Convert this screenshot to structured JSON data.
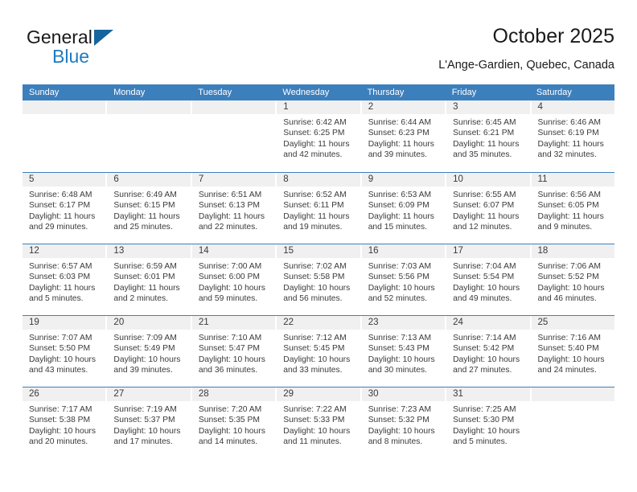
{
  "brand": {
    "word_one": "General",
    "word_two": "Blue",
    "accent_color": "#1f7bc1",
    "triangle_color": "#14659e"
  },
  "header": {
    "title": "October 2025",
    "location": "L'Ange-Gardien, Quebec, Canada"
  },
  "calendar": {
    "header_bg": "#3c7fbd",
    "daynum_bg": "#f0f0f0",
    "weekdays": [
      "Sunday",
      "Monday",
      "Tuesday",
      "Wednesday",
      "Thursday",
      "Friday",
      "Saturday"
    ],
    "labels": {
      "sunrise": "Sunrise:",
      "sunset": "Sunset:",
      "daylight": "Daylight:"
    },
    "weeks": [
      [
        {
          "day": "",
          "empty": true
        },
        {
          "day": "",
          "empty": true
        },
        {
          "day": "",
          "empty": true
        },
        {
          "day": "1",
          "sunrise": "Sunrise: 6:42 AM",
          "sunset": "Sunset: 6:25 PM",
          "daylight_line1": "Daylight: 11 hours",
          "daylight_line2": "and 42 minutes."
        },
        {
          "day": "2",
          "sunrise": "Sunrise: 6:44 AM",
          "sunset": "Sunset: 6:23 PM",
          "daylight_line1": "Daylight: 11 hours",
          "daylight_line2": "and 39 minutes."
        },
        {
          "day": "3",
          "sunrise": "Sunrise: 6:45 AM",
          "sunset": "Sunset: 6:21 PM",
          "daylight_line1": "Daylight: 11 hours",
          "daylight_line2": "and 35 minutes."
        },
        {
          "day": "4",
          "sunrise": "Sunrise: 6:46 AM",
          "sunset": "Sunset: 6:19 PM",
          "daylight_line1": "Daylight: 11 hours",
          "daylight_line2": "and 32 minutes."
        }
      ],
      [
        {
          "day": "5",
          "sunrise": "Sunrise: 6:48 AM",
          "sunset": "Sunset: 6:17 PM",
          "daylight_line1": "Daylight: 11 hours",
          "daylight_line2": "and 29 minutes."
        },
        {
          "day": "6",
          "sunrise": "Sunrise: 6:49 AM",
          "sunset": "Sunset: 6:15 PM",
          "daylight_line1": "Daylight: 11 hours",
          "daylight_line2": "and 25 minutes."
        },
        {
          "day": "7",
          "sunrise": "Sunrise: 6:51 AM",
          "sunset": "Sunset: 6:13 PM",
          "daylight_line1": "Daylight: 11 hours",
          "daylight_line2": "and 22 minutes."
        },
        {
          "day": "8",
          "sunrise": "Sunrise: 6:52 AM",
          "sunset": "Sunset: 6:11 PM",
          "daylight_line1": "Daylight: 11 hours",
          "daylight_line2": "and 19 minutes."
        },
        {
          "day": "9",
          "sunrise": "Sunrise: 6:53 AM",
          "sunset": "Sunset: 6:09 PM",
          "daylight_line1": "Daylight: 11 hours",
          "daylight_line2": "and 15 minutes."
        },
        {
          "day": "10",
          "sunrise": "Sunrise: 6:55 AM",
          "sunset": "Sunset: 6:07 PM",
          "daylight_line1": "Daylight: 11 hours",
          "daylight_line2": "and 12 minutes."
        },
        {
          "day": "11",
          "sunrise": "Sunrise: 6:56 AM",
          "sunset": "Sunset: 6:05 PM",
          "daylight_line1": "Daylight: 11 hours",
          "daylight_line2": "and 9 minutes."
        }
      ],
      [
        {
          "day": "12",
          "sunrise": "Sunrise: 6:57 AM",
          "sunset": "Sunset: 6:03 PM",
          "daylight_line1": "Daylight: 11 hours",
          "daylight_line2": "and 5 minutes."
        },
        {
          "day": "13",
          "sunrise": "Sunrise: 6:59 AM",
          "sunset": "Sunset: 6:01 PM",
          "daylight_line1": "Daylight: 11 hours",
          "daylight_line2": "and 2 minutes."
        },
        {
          "day": "14",
          "sunrise": "Sunrise: 7:00 AM",
          "sunset": "Sunset: 6:00 PM",
          "daylight_line1": "Daylight: 10 hours",
          "daylight_line2": "and 59 minutes."
        },
        {
          "day": "15",
          "sunrise": "Sunrise: 7:02 AM",
          "sunset": "Sunset: 5:58 PM",
          "daylight_line1": "Daylight: 10 hours",
          "daylight_line2": "and 56 minutes."
        },
        {
          "day": "16",
          "sunrise": "Sunrise: 7:03 AM",
          "sunset": "Sunset: 5:56 PM",
          "daylight_line1": "Daylight: 10 hours",
          "daylight_line2": "and 52 minutes."
        },
        {
          "day": "17",
          "sunrise": "Sunrise: 7:04 AM",
          "sunset": "Sunset: 5:54 PM",
          "daylight_line1": "Daylight: 10 hours",
          "daylight_line2": "and 49 minutes."
        },
        {
          "day": "18",
          "sunrise": "Sunrise: 7:06 AM",
          "sunset": "Sunset: 5:52 PM",
          "daylight_line1": "Daylight: 10 hours",
          "daylight_line2": "and 46 minutes."
        }
      ],
      [
        {
          "day": "19",
          "sunrise": "Sunrise: 7:07 AM",
          "sunset": "Sunset: 5:50 PM",
          "daylight_line1": "Daylight: 10 hours",
          "daylight_line2": "and 43 minutes."
        },
        {
          "day": "20",
          "sunrise": "Sunrise: 7:09 AM",
          "sunset": "Sunset: 5:49 PM",
          "daylight_line1": "Daylight: 10 hours",
          "daylight_line2": "and 39 minutes."
        },
        {
          "day": "21",
          "sunrise": "Sunrise: 7:10 AM",
          "sunset": "Sunset: 5:47 PM",
          "daylight_line1": "Daylight: 10 hours",
          "daylight_line2": "and 36 minutes."
        },
        {
          "day": "22",
          "sunrise": "Sunrise: 7:12 AM",
          "sunset": "Sunset: 5:45 PM",
          "daylight_line1": "Daylight: 10 hours",
          "daylight_line2": "and 33 minutes."
        },
        {
          "day": "23",
          "sunrise": "Sunrise: 7:13 AM",
          "sunset": "Sunset: 5:43 PM",
          "daylight_line1": "Daylight: 10 hours",
          "daylight_line2": "and 30 minutes."
        },
        {
          "day": "24",
          "sunrise": "Sunrise: 7:14 AM",
          "sunset": "Sunset: 5:42 PM",
          "daylight_line1": "Daylight: 10 hours",
          "daylight_line2": "and 27 minutes."
        },
        {
          "day": "25",
          "sunrise": "Sunrise: 7:16 AM",
          "sunset": "Sunset: 5:40 PM",
          "daylight_line1": "Daylight: 10 hours",
          "daylight_line2": "and 24 minutes."
        }
      ],
      [
        {
          "day": "26",
          "sunrise": "Sunrise: 7:17 AM",
          "sunset": "Sunset: 5:38 PM",
          "daylight_line1": "Daylight: 10 hours",
          "daylight_line2": "and 20 minutes."
        },
        {
          "day": "27",
          "sunrise": "Sunrise: 7:19 AM",
          "sunset": "Sunset: 5:37 PM",
          "daylight_line1": "Daylight: 10 hours",
          "daylight_line2": "and 17 minutes."
        },
        {
          "day": "28",
          "sunrise": "Sunrise: 7:20 AM",
          "sunset": "Sunset: 5:35 PM",
          "daylight_line1": "Daylight: 10 hours",
          "daylight_line2": "and 14 minutes."
        },
        {
          "day": "29",
          "sunrise": "Sunrise: 7:22 AM",
          "sunset": "Sunset: 5:33 PM",
          "daylight_line1": "Daylight: 10 hours",
          "daylight_line2": "and 11 minutes."
        },
        {
          "day": "30",
          "sunrise": "Sunrise: 7:23 AM",
          "sunset": "Sunset: 5:32 PM",
          "daylight_line1": "Daylight: 10 hours",
          "daylight_line2": "and 8 minutes."
        },
        {
          "day": "31",
          "sunrise": "Sunrise: 7:25 AM",
          "sunset": "Sunset: 5:30 PM",
          "daylight_line1": "Daylight: 10 hours",
          "daylight_line2": "and 5 minutes."
        },
        {
          "day": "",
          "empty": true
        }
      ]
    ]
  }
}
